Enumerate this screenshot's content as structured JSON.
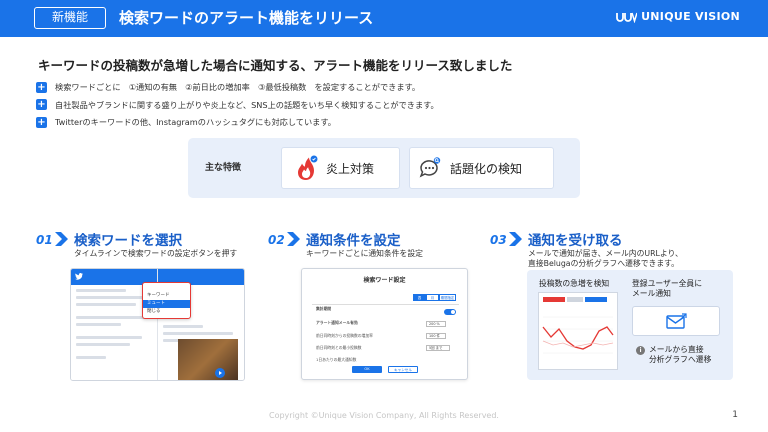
{
  "header": {
    "badge": "新機能",
    "title": "検索ワードのアラート機能をリリース",
    "logo_text": "UNIQUE VISION"
  },
  "headline": "キーワードの投稿数が急増した場合に通知する、アラート機能をリリース致しました",
  "bullets": [
    "検索ワードごとに　①通知の有無　②前日比の増加率　③最低投稿数　を設定することができます。",
    "自社製品やブランドに関する盛り上がりや炎上など、SNS上の話題をいち早く検知することができます。",
    "Twitterのキーワードの他、Instagramのハッシュタグにも対応しています。"
  ],
  "features": {
    "label": "主な特徴",
    "items": [
      {
        "label": "炎上対策",
        "icon": "fire-icon"
      },
      {
        "label": "話題化の検知",
        "icon": "chat-search-icon"
      }
    ]
  },
  "steps": [
    {
      "num": "01",
      "title": "検索ワードを選択",
      "sub": "タイムラインで検索ワードの設定ボタンを押す",
      "menu": [
        "キーワード",
        "ミュート",
        "閉じる"
      ]
    },
    {
      "num": "02",
      "title": "通知条件を設定",
      "sub": "キーワードごとに通知条件を設定",
      "dialog": {
        "title": "検索ワード設定",
        "section": "集計期間",
        "segments": [
          "週",
          "月",
          "期間指定"
        ],
        "alert_label": "アラート通知メール有効",
        "rows": [
          {
            "label": "前日同時刻からの投稿数の増加率",
            "value": "200 %"
          },
          {
            "label": "前日同時刻との最小投稿数",
            "value": "100 件"
          },
          {
            "label": "1日あたりの最大通知数",
            "value": "5回 まで"
          }
        ],
        "ok": "OK",
        "cancel": "キャンセル"
      }
    },
    {
      "num": "03",
      "title": "通知を受け取る",
      "sub": [
        "メールで通知が届き、メール内のURLより、",
        "直接Belugaの分析グラフへ遷移できます。"
      ],
      "chart_label": "投稿数の急増を検知",
      "mail_label": [
        "登録ユーザー全員に",
        "メール通知"
      ],
      "note": [
        "メールから直接",
        "分析グラフへ遷移"
      ]
    }
  ],
  "footer": "Copyright ©Unique Vision Company, All Rights Reserved.",
  "page": "1",
  "colors": {
    "primary": "#1a73e8",
    "panel": "#e8effa",
    "accent": "#e53935"
  }
}
